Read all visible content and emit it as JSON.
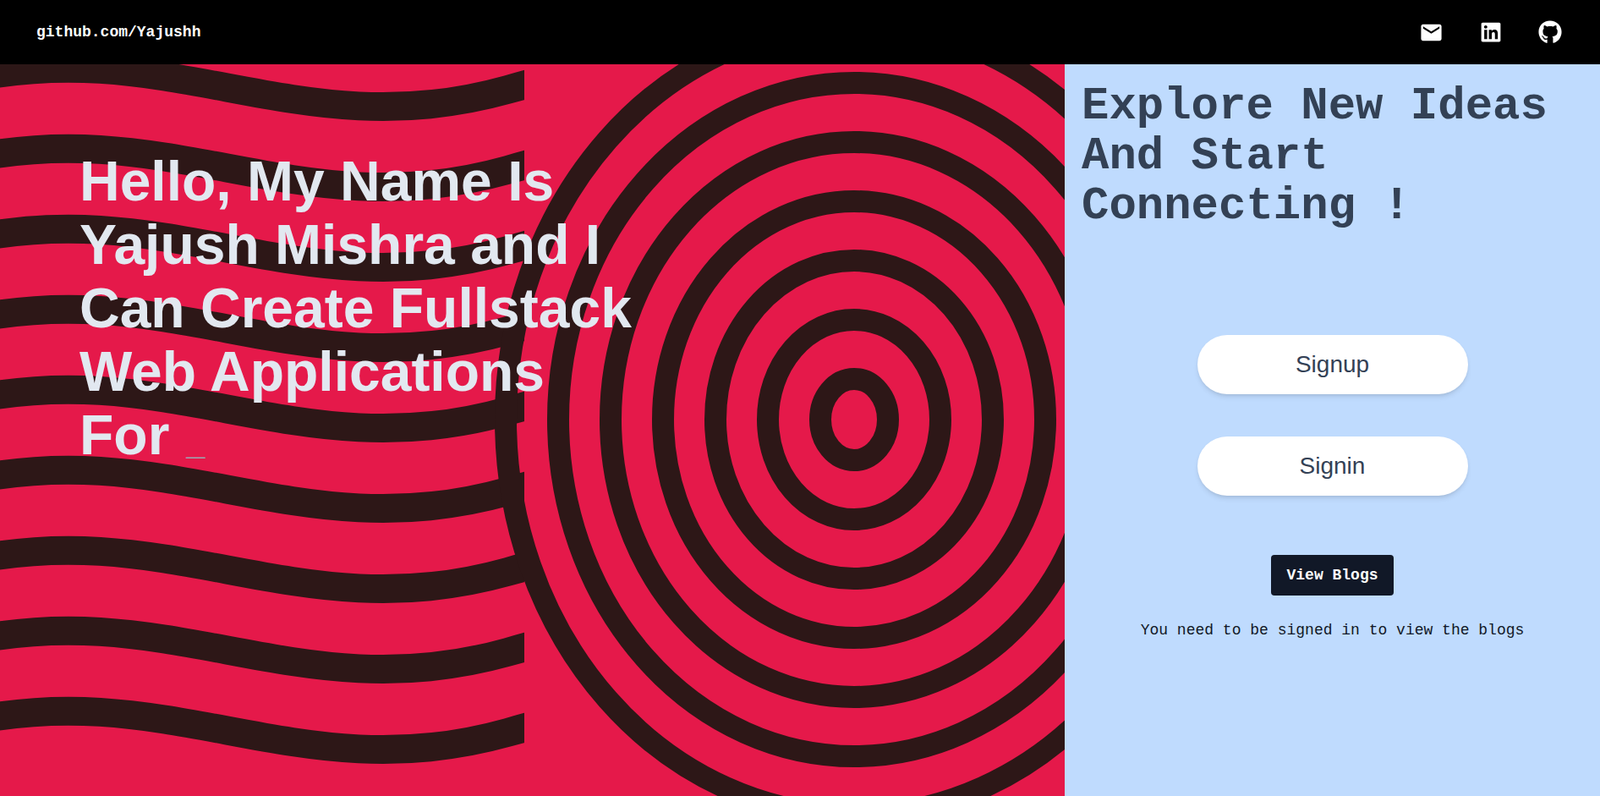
{
  "nav": {
    "brand": "github.com/Yajushh"
  },
  "hero": {
    "headline_lines": [
      "Hello, My Name Is",
      "Yajush Mishra and I",
      "Can Create Fullstack",
      "Web Applications",
      "For"
    ],
    "cursor": "_"
  },
  "panel": {
    "heading": "Explore New Ideas And Start Connecting !",
    "buttons": [
      "Signup",
      "Signin"
    ],
    "view_button": "View Blogs",
    "note": "You need to be signed in to view the blogs"
  }
}
